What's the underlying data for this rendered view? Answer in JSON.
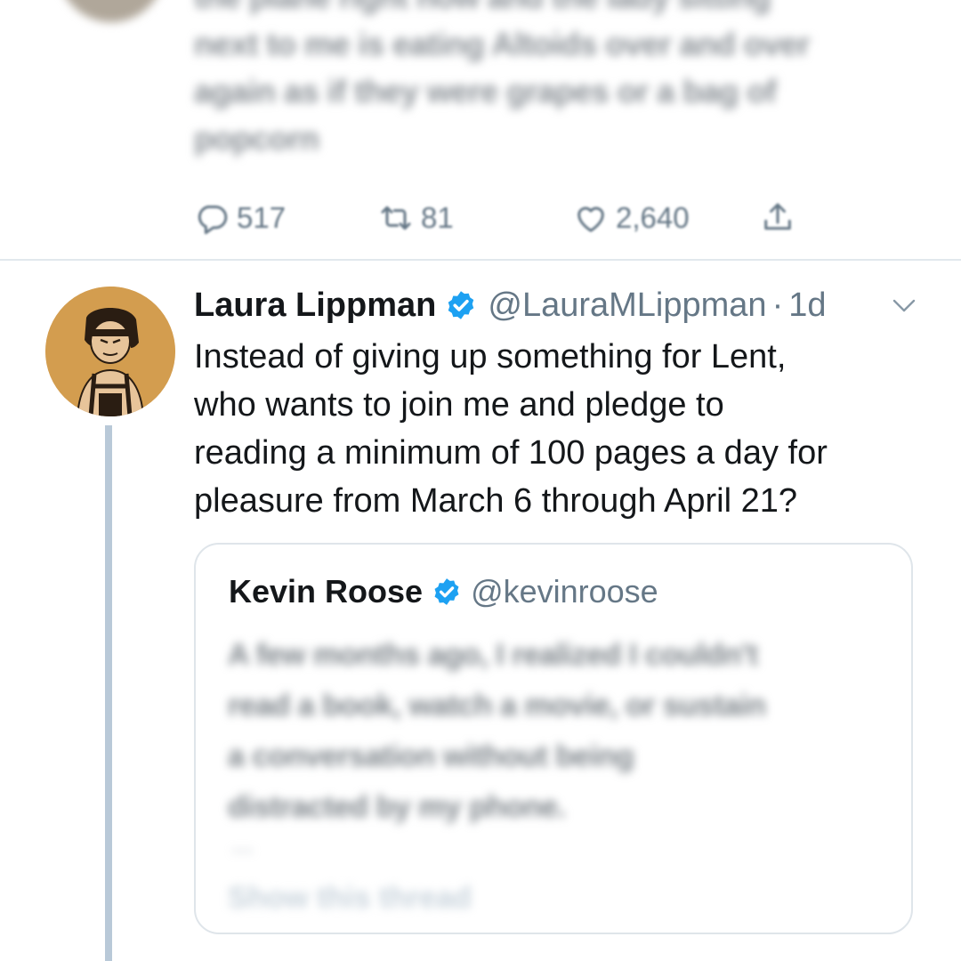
{
  "previous_tweet": {
    "text_lines": [
      "the plane right now and the lady sitting",
      "next to me is eating Altoids over and over",
      "again as if they were grapes or a bag of",
      "popcorn"
    ],
    "replies": "517",
    "retweets": "81",
    "likes": "2,640"
  },
  "tweet": {
    "author_name": "Laura Lippman",
    "handle": "@LauraMLippman",
    "separator": "·",
    "time": "1d",
    "body_lines": [
      "Instead of giving up something for Lent,",
      "who wants to join me and pledge to",
      "reading a minimum of 100 pages a day for",
      "pleasure from March 6 through April 21?"
    ]
  },
  "quoted_tweet": {
    "author_name": "Kevin Roose",
    "handle": "@kevinroose",
    "text_lines": [
      "A few months ago, I realized I couldn't",
      "read a book, watch a movie, or sustain",
      "a conversation without being",
      "distracted by my phone."
    ],
    "ellipsis": "...",
    "thread_link": "Show this thread"
  },
  "colors": {
    "verified_blue": "#1da1f2",
    "secondary_text": "#657786",
    "thread_line": "#b9c9d8",
    "avatar_bg": "#d39d4f"
  },
  "icons": [
    "reply-icon",
    "retweet-icon",
    "like-icon",
    "share-icon",
    "verified-badge-icon",
    "chevron-down-icon"
  ]
}
